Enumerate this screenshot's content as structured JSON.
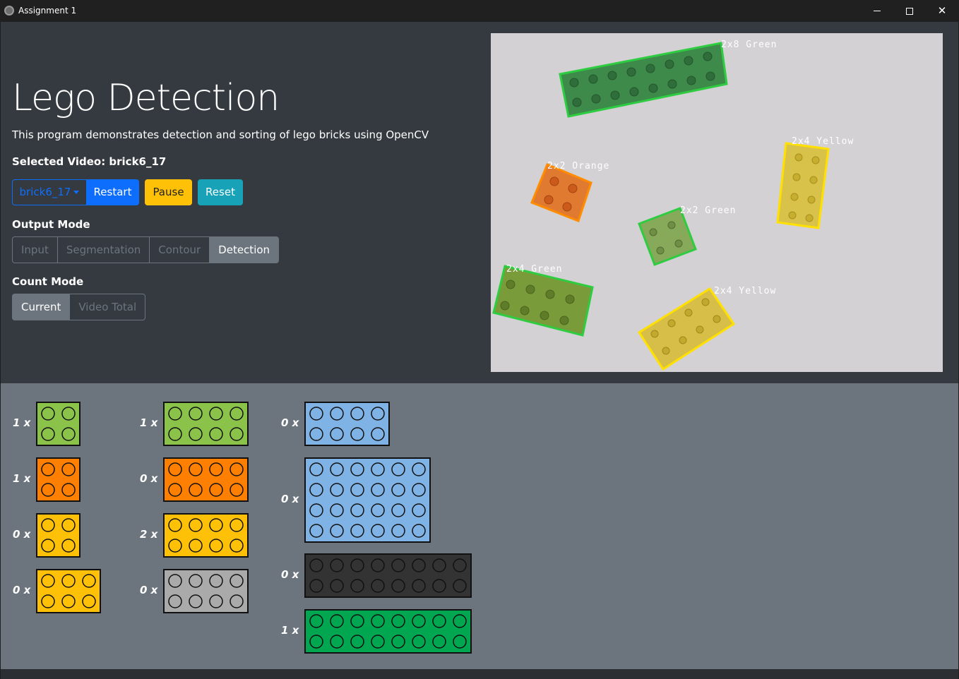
{
  "window": {
    "title": "Assignment 1",
    "minimize_glyph": "",
    "maximize_glyph": "",
    "close_glyph": "✕"
  },
  "header": {
    "title": "Lego Detection",
    "subtitle": "This program demonstrates detection and sorting of lego bricks using OpenCV",
    "selected_video": "Selected Video: brick6_17"
  },
  "controls": {
    "video_select": "brick6_17",
    "restart": "Restart",
    "pause": "Pause",
    "reset": "Reset"
  },
  "output_mode": {
    "label": "Output Mode",
    "options": [
      "Input",
      "Segmentation",
      "Contour",
      "Detection"
    ],
    "selected": "Detection"
  },
  "count_mode": {
    "label": "Count Mode",
    "options": [
      "Current",
      "Video Total"
    ],
    "selected": "Current"
  },
  "detections": [
    {
      "label": "2x8 Green",
      "color": "#2ecc40"
    },
    {
      "label": "2x4 Yellow",
      "color": "#ffe000"
    },
    {
      "label": "2x2 Orange",
      "color": "#ff8c00"
    },
    {
      "label": "2x2 Green",
      "color": "#2ecc40"
    },
    {
      "label": "2x4 Green",
      "color": "#2ecc40"
    },
    {
      "label": "2x4 Yellow",
      "color": "#ffe000"
    }
  ],
  "brick_counts": [
    {
      "count": "1 x",
      "color": "#8bc34a",
      "size": "2x2"
    },
    {
      "count": "1 x",
      "color": "#ff8000",
      "size": "2x2"
    },
    {
      "count": "0 x",
      "color": "#ffc107",
      "size": "2x2"
    },
    {
      "count": "0 x",
      "color": "#ffc107",
      "size": "2x3"
    },
    {
      "count": "1 x",
      "color": "#8bc34a",
      "size": "2x4"
    },
    {
      "count": "0 x",
      "color": "#ff8000",
      "size": "2x4"
    },
    {
      "count": "2 x",
      "color": "#ffc107",
      "size": "2x4"
    },
    {
      "count": "0 x",
      "color": "#aaaaaa",
      "size": "2x4"
    },
    {
      "count": "0 x",
      "color": "#7fb2e5",
      "size": "2x4"
    },
    {
      "count": "0 x",
      "color": "#7fb2e5",
      "size": "4x6"
    },
    {
      "count": "0 x",
      "color": "#333333",
      "size": "2x8"
    },
    {
      "count": "1 x",
      "color": "#00a650",
      "size": "2x8"
    }
  ]
}
